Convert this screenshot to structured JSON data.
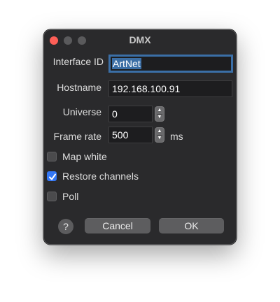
{
  "window": {
    "title": "DMX"
  },
  "form": {
    "interface_id": {
      "label": "Interface ID",
      "value": "ArtNet"
    },
    "hostname": {
      "label": "Hostname",
      "value": "192.168.100.91"
    },
    "universe": {
      "label": "Universe",
      "value": "0"
    },
    "frame_rate": {
      "label": "Frame rate",
      "value": "500",
      "unit": "ms"
    }
  },
  "checkboxes": [
    {
      "label": "Map white",
      "checked": false
    },
    {
      "label": "Restore channels",
      "checked": true
    },
    {
      "label": "Poll",
      "checked": false
    }
  ],
  "buttons": {
    "help": "?",
    "cancel": "Cancel",
    "ok": "OK"
  },
  "colors": {
    "accent": "#3478f6",
    "close": "#fe5f57",
    "window_bg": "#2a2a2c"
  }
}
